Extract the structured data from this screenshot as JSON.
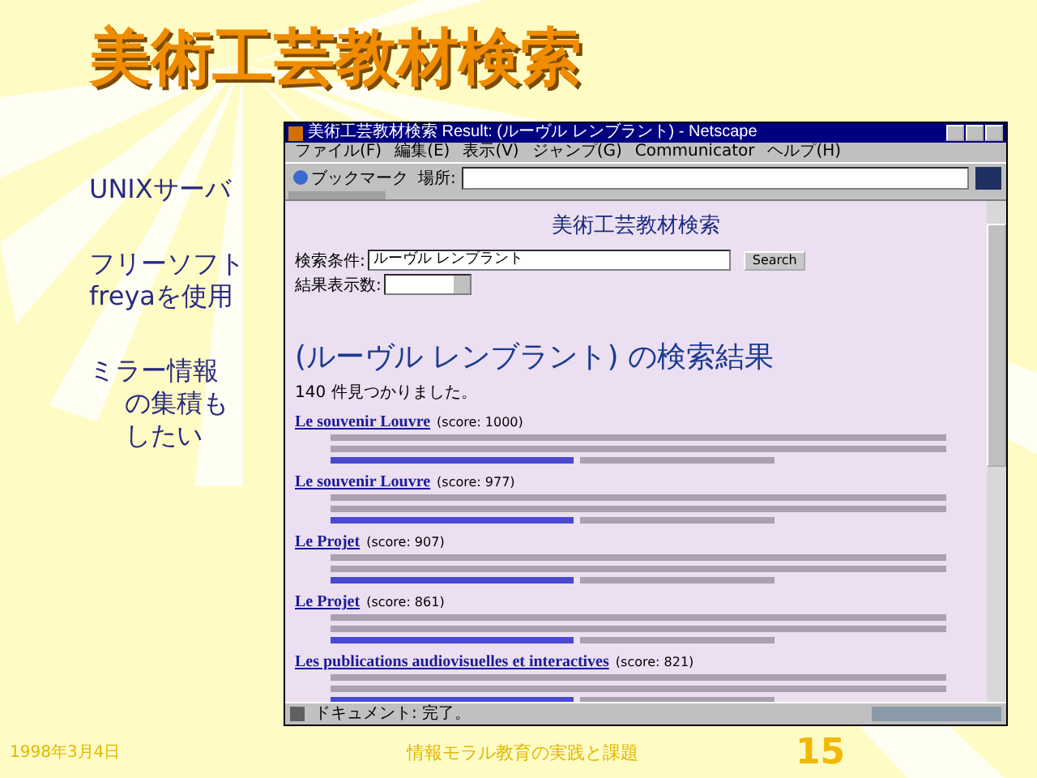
{
  "slide": {
    "title": "美術工芸教材検索",
    "bullets": [
      {
        "kind": "plain",
        "lines": [
          "UNIXサーバ"
        ]
      },
      {
        "kind": "plain",
        "lines": [
          "フリーソフト",
          "freyaを使用"
        ]
      },
      {
        "kind": "hanging",
        "lines": [
          "ミラー情報",
          "の集積も",
          "したい"
        ]
      }
    ],
    "date": "1998年3月4日",
    "footer": "情報モラル教育の実践と課題",
    "page_number": "15"
  },
  "browser": {
    "title": "美術工芸教材検索 Result: (ルーヴル レンブラント) - Netscape",
    "menu": [
      "ファイル(F)",
      "編集(E)",
      "表示(V)",
      "ジャンプ(G)",
      "Communicator",
      "ヘルプ(H)"
    ],
    "toolbar": {
      "bookmarks": "ブックマーク",
      "location_label": "場所:"
    },
    "page": {
      "heading": "美術工芸教材検索",
      "query_label": "検索条件:",
      "query_value": "ルーヴル レンブラント",
      "search_button": "Search",
      "count_label": "結果表示数:",
      "results_title": "(ルーヴル レンブラント) の検索結果",
      "found": "140 件見つかりました。",
      "results": [
        {
          "title": "Le souvenir Louvre",
          "score": "(score: 1000)"
        },
        {
          "title": "Le souvenir Louvre",
          "score": "(score: 977)"
        },
        {
          "title": "Le Projet",
          "score": "(score: 907)"
        },
        {
          "title": "Le Projet",
          "score": "(score: 861)"
        },
        {
          "title": "Les publications audiovisuelles et interactives",
          "score": "(score: 821)"
        }
      ]
    },
    "status": "ドキュメント: 完了。"
  }
}
